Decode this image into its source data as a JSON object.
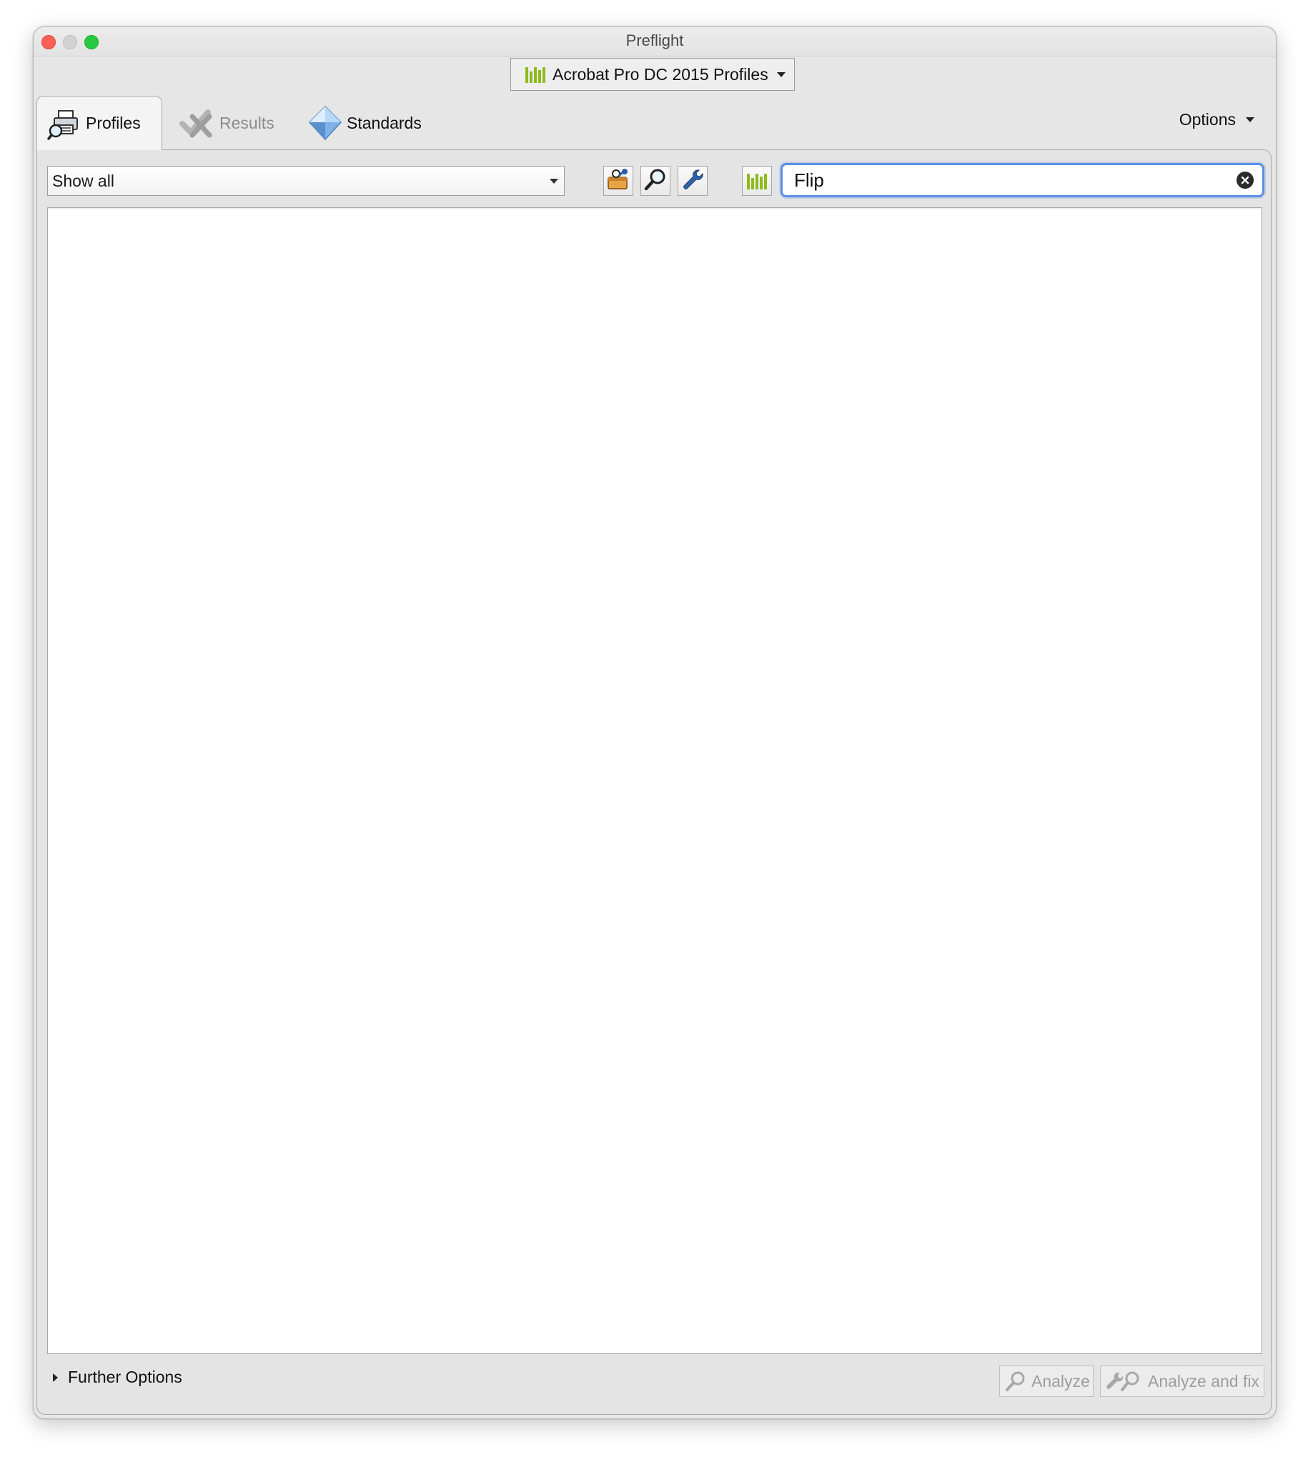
{
  "window": {
    "title": "Preflight"
  },
  "profile_set": {
    "label": "Acrobat Pro DC 2015 Profiles",
    "icon": "library-bars-icon",
    "accent": "#8dbb1d"
  },
  "tabs": [
    {
      "label": "Profiles",
      "icon": "printer-magnifier-icon",
      "active": true
    },
    {
      "label": "Results",
      "icon": "results-check-icon",
      "active": false
    },
    {
      "label": "Standards",
      "icon": "diamond-icon",
      "active": false
    }
  ],
  "options": {
    "label": "Options"
  },
  "toolbar": {
    "filter": {
      "selected": "Show all"
    },
    "buttons": [
      {
        "name": "fixup-toolbox-button",
        "icon": "toolbox-icon"
      },
      {
        "name": "single-checks-button",
        "icon": "magnifier-icon"
      },
      {
        "name": "single-fixups-button",
        "icon": "wrench-icon"
      },
      {
        "name": "library-filter-button",
        "icon": "library-bars-icon"
      }
    ],
    "search": {
      "value": "Flip"
    }
  },
  "footer": {
    "further_options": "Further Options",
    "analyze": "Analyze",
    "analyze_and_fix": "Analyze and fix"
  },
  "colors": {
    "focus_ring": "#5b8ee6",
    "accent_green": "#8dbb1d"
  }
}
